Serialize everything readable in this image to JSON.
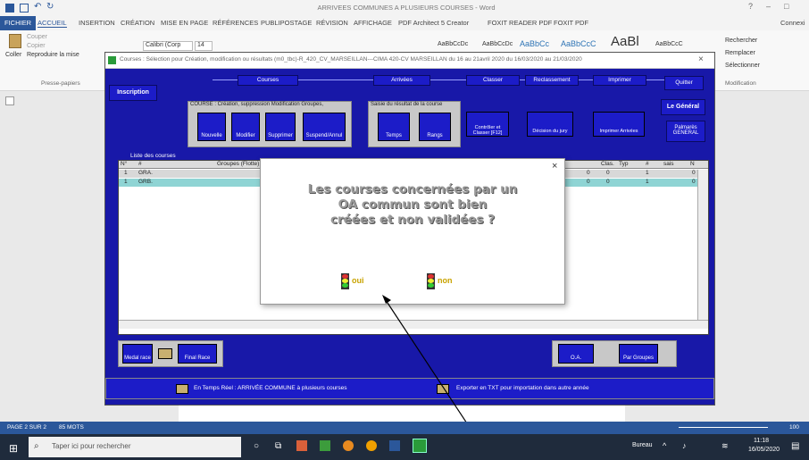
{
  "word": {
    "title": "ARRIVEES COMMUNES A PLUSIEURS COURSES - Word",
    "tabs": [
      "FICHIER",
      "ACCUEIL",
      "INSERTION",
      "CRÉATION",
      "MISE EN PAGE",
      "RÉFÉRENCES",
      "PUBLIPOSTAGE",
      "RÉVISION",
      "AFFICHAGE",
      "PDF Architect 5 Creator",
      "FOXIT READER PDF",
      "FOXIT PDF"
    ],
    "account": "Connexi",
    "clipboard": {
      "cut": "Couper",
      "copy": "Copier",
      "paste": "Coller",
      "format": "Reproduire la mise",
      "group": "Presse-papiers"
    },
    "font": {
      "name": "Calibri (Corp",
      "size": "14"
    },
    "styles": [
      "AaBbCcDc",
      "AaBbCcDc",
      "AaBbCc",
      "AaBbCcC",
      "AaBl",
      "AaBbCcC"
    ],
    "editing": {
      "find": "Rechercher",
      "replace": "Remplacer",
      "select": "Sélectionner",
      "group": "Modification"
    },
    "status": {
      "page": "PAGE 2 SUR 2",
      "words": "85 MOTS",
      "zoom": "100"
    }
  },
  "app": {
    "title": "Courses : Sélection pour Création, modification ou résultats   (m0_tbc)-R_420_CV_MARSEILLAN---CIMA 420-CV MARSEILLAN du 16 au 21avril 2020 du 16/03/2020 au 21/03/2020",
    "flow": [
      "Courses",
      "Arrivées",
      "Classer",
      "Reclassement",
      "Imprimer"
    ],
    "inscription": "Inscription",
    "quitter": "Quitter",
    "general": "Le Général",
    "palmares": "Palmarès GENERAL",
    "section_course": "COURSE : Création, suppression Modification Groupes,",
    "section_saisie": "Saisie du résultat de la course",
    "buttons_course": [
      "Nouvelle",
      "Modifier",
      "Supprimer",
      "Suspend/Annul"
    ],
    "buttons_saisie": [
      "Temps",
      "Rangs"
    ],
    "controler": "Contrôler et Classer [F12]",
    "decision": "Décision du jury",
    "imprimer": "Imprimer Arrivées",
    "list_title": "Liste des courses",
    "list_headers": [
      "N°",
      "#",
      "Groupes (Flotte)",
      "Clas.",
      "Typ",
      "#",
      "sais",
      "N"
    ],
    "rows": [
      {
        "num": "1",
        "group": "GRA.",
        "v1": "0",
        "v2": "0",
        "v3": "1",
        "v4": "0"
      },
      {
        "num": "1",
        "group": "GRB.",
        "v1": "0",
        "v2": "0",
        "v3": "1",
        "v4": "0"
      }
    ],
    "medal_race": "Medal race",
    "final_race": "Final Race",
    "oa": "O.A.",
    "par_groupes": "Par Groupes",
    "bottom_left": "En Temps Réel : ARRIVÉE COMMUNE à plusieurs courses",
    "bottom_right": "Exporter en TXT pour importation dans autre année"
  },
  "dialog": {
    "line1": "Les courses concernées par un",
    "line2": "OA commun sont bien",
    "line3": "créées et non validées ?",
    "yes": "oui",
    "no": "non",
    "close": "×"
  },
  "taskbar": {
    "search": "Taper ici pour rechercher",
    "bureau": "Bureau",
    "time": "11:18",
    "date": "16/05/2020"
  }
}
